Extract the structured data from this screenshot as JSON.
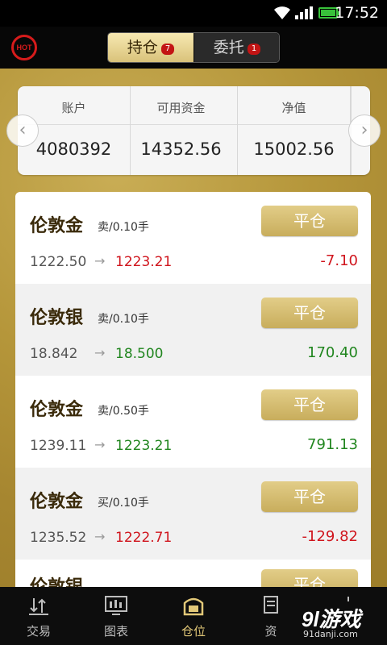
{
  "status_bar": {
    "time": "17:52"
  },
  "header": {
    "hot_label": "HOT",
    "tabs": [
      {
        "label": "持仓",
        "badge": "7",
        "active": true
      },
      {
        "label": "委托",
        "badge": "1",
        "active": false
      }
    ]
  },
  "account": {
    "columns": [
      {
        "label": "账户",
        "value": "4080392"
      },
      {
        "label": "可用资金",
        "value": "14352.56"
      },
      {
        "label": "净值",
        "value": "15002.56"
      }
    ],
    "prev_icon": "chevron-left-icon",
    "next_icon": "chevron-right-icon"
  },
  "positions": [
    {
      "name": "伦敦金",
      "side": "卖/0.10手",
      "button": "平仓",
      "open": "1222.50",
      "current": "1223.21",
      "current_color": "red",
      "pnl": "-7.10",
      "pnl_color": "red"
    },
    {
      "name": "伦敦银",
      "side": "卖/0.10手",
      "button": "平仓",
      "open": "18.842",
      "current": "18.500",
      "current_color": "green",
      "pnl": "170.40",
      "pnl_color": "green"
    },
    {
      "name": "伦敦金",
      "side": "卖/0.50手",
      "button": "平仓",
      "open": "1239.11",
      "current": "1223.21",
      "current_color": "green",
      "pnl": "791.13",
      "pnl_color": "green"
    },
    {
      "name": "伦敦金",
      "side": "买/0.10手",
      "button": "平仓",
      "open": "1235.52",
      "current": "1222.71",
      "current_color": "red",
      "pnl": "-129.82",
      "pnl_color": "red"
    },
    {
      "name": "伦敦银",
      "side": "",
      "button": "平仓",
      "open": "",
      "current": "",
      "current_color": "red",
      "pnl": "",
      "pnl_color": "red"
    }
  ],
  "arrow_symbol": "→",
  "bottom_nav": [
    {
      "label": "交易",
      "icon": "trade-icon",
      "active": false
    },
    {
      "label": "图表",
      "icon": "chart-icon",
      "active": false
    },
    {
      "label": "仓位",
      "icon": "position-icon",
      "active": true
    },
    {
      "label": "资",
      "icon": "funds-icon",
      "active": false
    },
    {
      "label": "",
      "icon": "more-icon",
      "active": false
    }
  ],
  "watermark": {
    "logo": "9l游戏",
    "url": "91danji.com"
  },
  "colors": {
    "gold": "#b5963a",
    "red": "#d0151d",
    "green": "#21861f",
    "accent": "#e2c878"
  }
}
